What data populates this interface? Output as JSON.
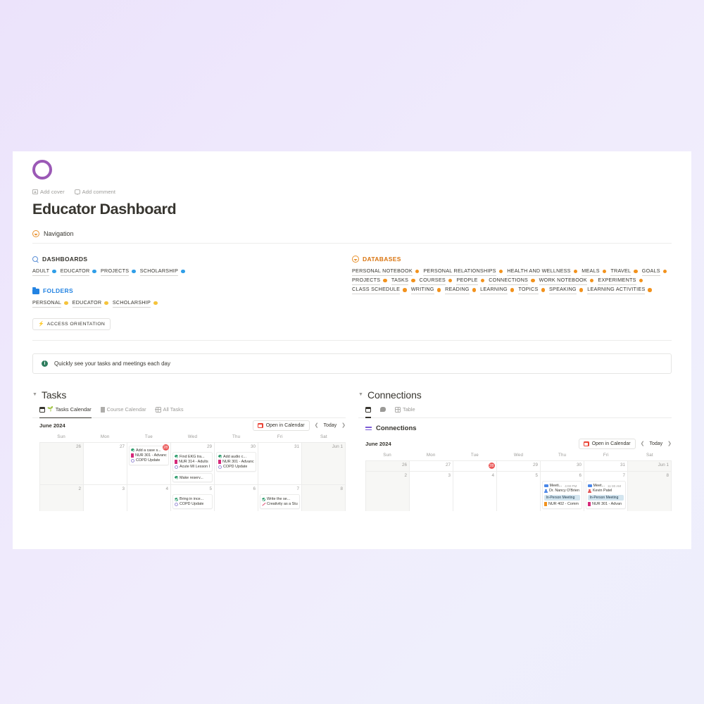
{
  "theme": {
    "bg_start": "#ece3fb",
    "bg_end": "#eeeefb",
    "accent_purple": "#9b59b6",
    "orange": "#d9730d",
    "blue": "#2383e2",
    "today_red": "#eb5757"
  },
  "page": {
    "icon": "purple-ring-icon",
    "add_cover": "Add cover",
    "add_comment": "Add comment",
    "title": "Educator Dashboard",
    "navigation_label": "Navigation",
    "navigation_icon": "compass-icon"
  },
  "navigation": {
    "dashboards": {
      "icon": "magnifier-icon",
      "heading": "DASHBOARDS",
      "dot_color": "blue",
      "items": [
        "ADULT",
        "EDUCATOR",
        "PROJECTS",
        "SCHOLARSHIP"
      ]
    },
    "folders": {
      "icon": "folder-icon",
      "heading": "FOLDERS",
      "dot_color": "yellow",
      "items": [
        "PERSONAL",
        "EDUCATOR",
        "SCHOLARSHIP"
      ]
    },
    "databases": {
      "icon": "compass-icon",
      "heading": "DATABASES",
      "dot_color": "orange",
      "items": [
        "PERSONAL NOTEBOOK",
        "PERSONAL RELATIONSHIPS",
        "HEALTH AND WELLNESS",
        "MEALS",
        "TRAVEL",
        "GOALS",
        "PROJECTS",
        "TASKS",
        "COURSES",
        "PEOPLE",
        "CONNECTIONS",
        "WORK NOTEBOOK",
        "EXPERIMENTS",
        "CLASS SCHEDULE",
        "WRITING",
        "READING",
        "LEARNING",
        "TOPICS",
        "SPEAKING",
        "LEARNING ACTIVITIES"
      ]
    },
    "access_button": {
      "label": "ACCESS ORIENTATION",
      "icon": "bolt-icon"
    }
  },
  "callout": {
    "icon": "info-icon",
    "text": "Quickly see your tasks and meetings each day"
  },
  "tasks_board": {
    "title": "Tasks",
    "tabs": [
      {
        "label": "Tasks Calendar",
        "icon": "calendar-icon",
        "active": true
      },
      {
        "label": "Course Calendar",
        "icon": "book-icon",
        "active": false
      },
      {
        "label": "All Tasks",
        "icon": "table-icon",
        "active": false
      }
    ],
    "calendar": {
      "month": "June 2024",
      "open_button": "Open in Calendar",
      "open_button_icon": "google-calendar-icon",
      "prev_icon": "chevron-left-icon",
      "today_label": "Today",
      "next_icon": "chevron-right-icon",
      "weekdays": [
        "Sun",
        "Mon",
        "Tue",
        "Wed",
        "Thu",
        "Fri",
        "Sat"
      ],
      "rows": [
        [
          {
            "day": "26",
            "weekend": true,
            "today": false,
            "cards": []
          },
          {
            "day": "27",
            "weekend": false,
            "today": false,
            "cards": []
          },
          {
            "day": "28",
            "weekend": false,
            "today": true,
            "cards": [
              {
                "lines": [
                  {
                    "icon": "check-icon",
                    "text": "Add a case s..."
                  },
                  {
                    "icon": "bookmark-icon",
                    "text": "NUR 301 - Advanc"
                  },
                  {
                    "icon": "circle-icon",
                    "text": "COPD Update"
                  }
                ]
              }
            ]
          },
          {
            "day": "29",
            "weekend": false,
            "today": false,
            "cards": [
              {
                "lines": [
                  {
                    "icon": "check-icon",
                    "text": "Find EKG tra..."
                  },
                  {
                    "icon": "bookmark-icon",
                    "text": "NUR 314 - Adults"
                  },
                  {
                    "icon": "circle-icon",
                    "text": "Acute MI Lesson I"
                  }
                ]
              },
              {
                "lines": [
                  {
                    "icon": "check-icon",
                    "text": "Make reserv..."
                  }
                ]
              }
            ]
          },
          {
            "day": "30",
            "weekend": false,
            "today": false,
            "cards": [
              {
                "lines": [
                  {
                    "icon": "check-icon",
                    "text": "Add audio c..."
                  },
                  {
                    "icon": "bookmark-icon",
                    "text": "NUR 301 - Advanc"
                  },
                  {
                    "icon": "circle-icon",
                    "text": "COPD Update"
                  }
                ]
              }
            ]
          },
          {
            "day": "31",
            "weekend": false,
            "today": false,
            "cards": []
          },
          {
            "day": "Jun 1",
            "weekend": true,
            "today": false,
            "cards": []
          }
        ],
        [
          {
            "day": "2",
            "weekend": true,
            "today": false,
            "cards": []
          },
          {
            "day": "3",
            "weekend": false,
            "today": false,
            "cards": []
          },
          {
            "day": "4",
            "weekend": false,
            "today": false,
            "cards": []
          },
          {
            "day": "5",
            "weekend": false,
            "today": false,
            "cards": [
              {
                "lines": [
                  {
                    "icon": "check-icon",
                    "text": "Bring in ince..."
                  },
                  {
                    "icon": "circle-icon",
                    "text": "COPD Update"
                  }
                ]
              }
            ]
          },
          {
            "day": "6",
            "weekend": false,
            "today": false,
            "cards": []
          },
          {
            "day": "7",
            "weekend": false,
            "today": false,
            "cards": [
              {
                "lines": [
                  {
                    "icon": "check-icon",
                    "text": "Write the se..."
                  },
                  {
                    "icon": "pen-icon",
                    "text": "Creativity as a Stu"
                  }
                ]
              }
            ]
          },
          {
            "day": "8",
            "weekend": true,
            "today": false,
            "cards": []
          }
        ]
      ]
    }
  },
  "connections_board": {
    "title": "Connections",
    "tabs": [
      {
        "label": "",
        "icon": "calendar-icon",
        "active": true
      },
      {
        "label": "",
        "icon": "comment-icon",
        "active": false
      },
      {
        "label": "Table",
        "icon": "table-icon",
        "active": false
      }
    ],
    "subtitle": "Connections",
    "subtitle_icon": "relation-arrows-icon",
    "calendar": {
      "month": "June 2024",
      "open_button": "Open in Calendar",
      "open_button_icon": "google-calendar-icon",
      "prev_icon": "chevron-left-icon",
      "today_label": "Today",
      "next_icon": "chevron-right-icon",
      "weekdays": [
        "Sun",
        "Mon",
        "Tue",
        "Wed",
        "Thu",
        "Fri",
        "Sat"
      ],
      "rows": [
        [
          {
            "day": "26",
            "weekend": true,
            "today": false,
            "cards": []
          },
          {
            "day": "27",
            "weekend": false,
            "today": false,
            "cards": []
          },
          {
            "day": "28",
            "weekend": false,
            "today": true,
            "cards": []
          },
          {
            "day": "29",
            "weekend": false,
            "today": false,
            "cards": []
          },
          {
            "day": "30",
            "weekend": false,
            "today": false,
            "cards": []
          },
          {
            "day": "31",
            "weekend": false,
            "today": false,
            "cards": []
          },
          {
            "day": "Jun 1",
            "weekend": true,
            "today": false,
            "cards": []
          }
        ],
        [
          {
            "day": "2",
            "weekend": true,
            "today": false,
            "cards": []
          },
          {
            "day": "3",
            "weekend": false,
            "today": false,
            "cards": []
          },
          {
            "day": "4",
            "weekend": false,
            "today": false,
            "cards": []
          },
          {
            "day": "5",
            "weekend": false,
            "today": false,
            "cards": []
          },
          {
            "day": "6",
            "weekend": false,
            "today": false,
            "cards": [
              {
                "lines": [
                  {
                    "icon": "video-icon",
                    "text": "Meeti...",
                    "time": "4:00 PM"
                  },
                  {
                    "icon": "person-icon",
                    "text": "Dr. Nancy O'Brien"
                  }
                ],
                "tag": "In-Person Meeting",
                "after": [
                  {
                    "icon": "bookmark-orange-icon",
                    "text": "NUR 402 - Comm"
                  }
                ]
              }
            ]
          },
          {
            "day": "7",
            "weekend": false,
            "today": false,
            "cards": [
              {
                "lines": [
                  {
                    "icon": "video-icon",
                    "text": "Meet...",
                    "time": "11:30 AM"
                  },
                  {
                    "icon": "person-red-icon",
                    "text": "Kevin Patel"
                  }
                ],
                "tag": "In-Person Meeting",
                "after": [
                  {
                    "icon": "bookmark-icon",
                    "text": "NUR 301 - Advan"
                  }
                ]
              }
            ]
          },
          {
            "day": "8",
            "weekend": true,
            "today": false,
            "cards": []
          }
        ]
      ]
    }
  }
}
